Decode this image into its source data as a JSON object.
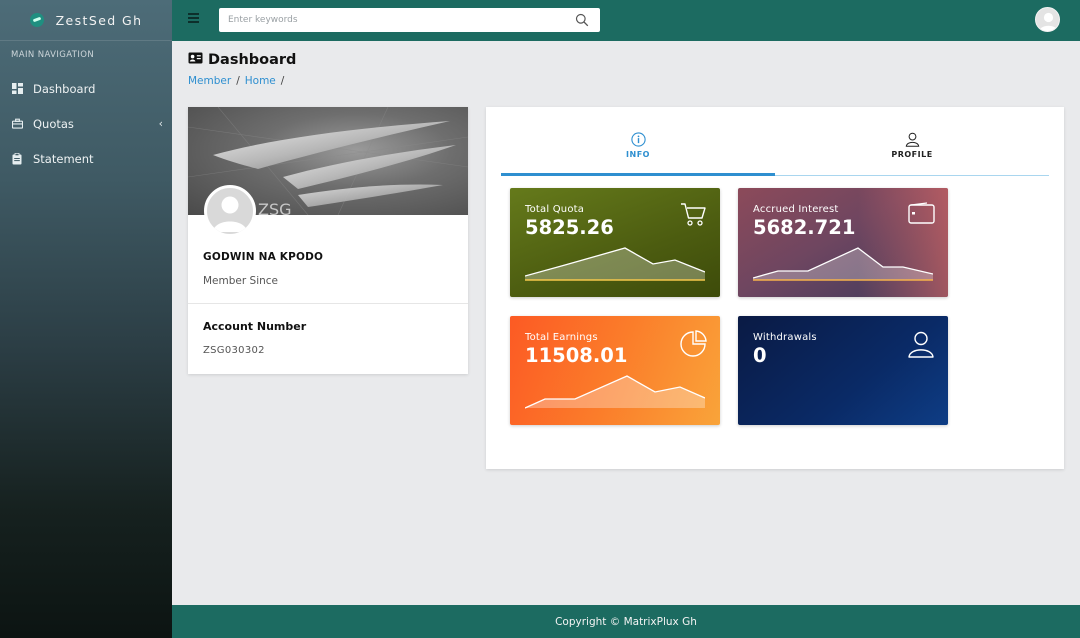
{
  "brand": {
    "name": "ZestSed Gh"
  },
  "sidebar": {
    "header": "MAIN NAVIGATION",
    "items": [
      {
        "label": "Dashboard",
        "icon": "dashboard-icon"
      },
      {
        "label": "Quotas",
        "icon": "briefcase-icon",
        "has_children": true
      },
      {
        "label": "Statement",
        "icon": "clipboard-icon"
      }
    ]
  },
  "topbar": {
    "search_placeholder": "Enter keywords"
  },
  "page": {
    "title": "Dashboard",
    "breadcrumb": [
      "Member",
      "Home"
    ]
  },
  "profile": {
    "name": "GODWIN NA KPODO",
    "member_since_label": "Member Since",
    "account_label": "Account Number",
    "account_number": "ZSG030302"
  },
  "tabs": [
    {
      "label": "INFO",
      "icon": "info-icon",
      "active": true
    },
    {
      "label": "PROFILE",
      "icon": "user-icon",
      "active": false
    }
  ],
  "stats": {
    "total_quota": {
      "label": "Total Quota",
      "value": "5825.26",
      "icon": "cart-icon"
    },
    "accrued_interest": {
      "label": "Accrued Interest",
      "value": "5682.721",
      "icon": "wallet-icon"
    },
    "total_earnings": {
      "label": "Total Earnings",
      "value": "11508.01",
      "icon": "pie-chart-icon"
    },
    "withdrawals": {
      "label": "Withdrawals",
      "value": "0",
      "icon": "user-icon"
    }
  },
  "footer": {
    "text": "Copyright © MatrixPlux Gh"
  },
  "colors": {
    "primary": "#1c6b61",
    "link": "#2e8fd0",
    "quota_card": "#5a6e16",
    "interest_card": "#7a4a5e",
    "earnings_card": "#fb7d2a",
    "withdrawals_card": "#0a2a66"
  }
}
